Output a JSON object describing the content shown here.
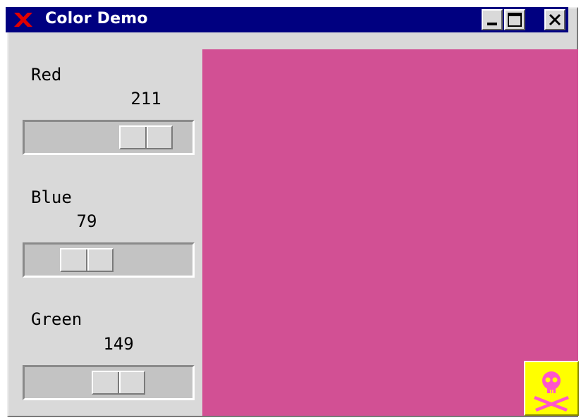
{
  "window": {
    "title": "Color Demo"
  },
  "sliders": [
    {
      "label": "Red",
      "value": "211",
      "fraction": 0.827
    },
    {
      "label": "Blue",
      "value": "79",
      "fraction": 0.31
    },
    {
      "label": "Green",
      "value": "149",
      "fraction": 0.584
    }
  ],
  "colors": {
    "titlebar": "#000080",
    "preview": "#d25094",
    "skull_bg": "#ffff00",
    "skull_fg": "#ff55cc"
  }
}
